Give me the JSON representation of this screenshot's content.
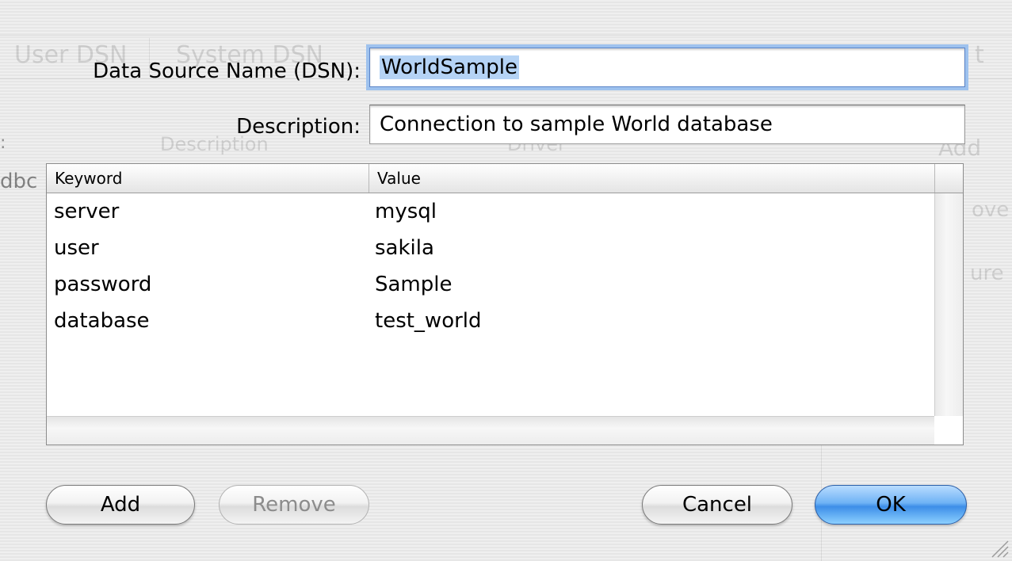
{
  "form": {
    "dsn_label": "Data Source Name (DSN):",
    "dsn_value": "WorldSample",
    "description_label": "Description:",
    "description_value": "Connection to sample World database"
  },
  "table": {
    "columns": [
      "Keyword",
      "Value"
    ],
    "rows": [
      {
        "keyword": "server",
        "value": "mysql"
      },
      {
        "keyword": "user",
        "value": "sakila"
      },
      {
        "keyword": "password",
        "value": "Sample"
      },
      {
        "keyword": "database",
        "value": "test_world"
      }
    ]
  },
  "buttons": {
    "add": "Add",
    "remove": "Remove",
    "cancel": "Cancel",
    "ok": "OK"
  },
  "background_window": {
    "tab_user_dsn": "User DSN",
    "tab_system_dsn": "System DSN",
    "column_description": "Description",
    "column_driver": "Driver",
    "add_button": "Add",
    "fragment_left": "dbc",
    "fragment_t": "t",
    "fragment_remove": "ove",
    "fragment_configure": "ure",
    "fragment_colon": ":"
  },
  "colors": {
    "focus_ring": "#9ec2ee",
    "selection": "#b5d3f5",
    "default_button": "#3d8ee8"
  }
}
